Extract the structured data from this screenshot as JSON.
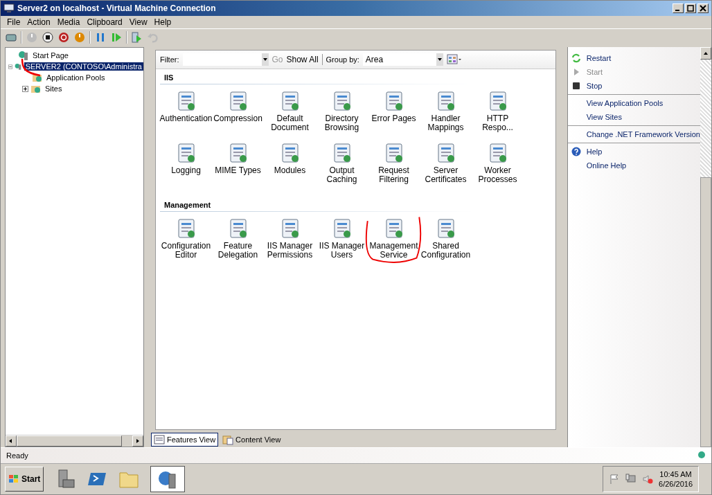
{
  "window": {
    "title": "Server2 on localhost - Virtual Machine Connection"
  },
  "menu": [
    "File",
    "Action",
    "Media",
    "Clipboard",
    "View",
    "Help"
  ],
  "tree": [
    {
      "label": "Start Page",
      "selected": false
    },
    {
      "label": "SERVER2 (CONTOSO\\Administra",
      "selected": true,
      "expanded": true,
      "children": [
        {
          "label": "Application Pools",
          "selected": false
        },
        {
          "label": "Sites",
          "selected": false,
          "expanded": false
        }
      ]
    }
  ],
  "filter_bar": {
    "filter_label": "Filter:",
    "go": "Go",
    "show_all": "Show All",
    "group_by_label": "Group by:",
    "group_by_value": "Area"
  },
  "sections": [
    {
      "title": "IIS",
      "features": [
        {
          "label": "Authentication"
        },
        {
          "label": "Compression"
        },
        {
          "label": "Default Document"
        },
        {
          "label": "Directory Browsing"
        },
        {
          "label": "Error Pages"
        },
        {
          "label": "Handler Mappings"
        },
        {
          "label": "HTTP Respo..."
        },
        {
          "label": "Logging"
        },
        {
          "label": "MIME Types"
        },
        {
          "label": "Modules"
        },
        {
          "label": "Output Caching"
        },
        {
          "label": "Request Filtering"
        },
        {
          "label": "Server Certificates"
        },
        {
          "label": "Worker Processes"
        }
      ]
    },
    {
      "title": "Management",
      "features": [
        {
          "label": "Configuration Editor"
        },
        {
          "label": "Feature Delegation"
        },
        {
          "label": "IIS Manager Permissions"
        },
        {
          "label": "IIS Manager Users"
        },
        {
          "label": "Management Service",
          "annotated": true
        },
        {
          "label": "Shared Configuration"
        }
      ]
    }
  ],
  "view_tabs": [
    {
      "label": "Features View",
      "selected": true
    },
    {
      "label": "Content View",
      "selected": false
    }
  ],
  "actions": [
    [
      {
        "label": "Restart",
        "kind": "restart",
        "disabled": false
      },
      {
        "label": "Start",
        "kind": "start",
        "disabled": true
      },
      {
        "label": "Stop",
        "kind": "stop",
        "disabled": false
      }
    ],
    [
      {
        "label": "View Application Pools",
        "kind": "plain",
        "disabled": false
      },
      {
        "label": "View Sites",
        "kind": "plain",
        "disabled": false
      }
    ],
    [
      {
        "label": "Change .NET Framework Version",
        "kind": "plain",
        "disabled": false
      }
    ],
    [
      {
        "label": "Help",
        "kind": "help",
        "disabled": false
      },
      {
        "label": "Online Help",
        "kind": "plain",
        "disabled": false
      }
    ]
  ],
  "status_bar": {
    "text": "Ready"
  },
  "taskbar": {
    "start": "Start",
    "time": "10:45 AM",
    "date": "6/26/2016"
  }
}
